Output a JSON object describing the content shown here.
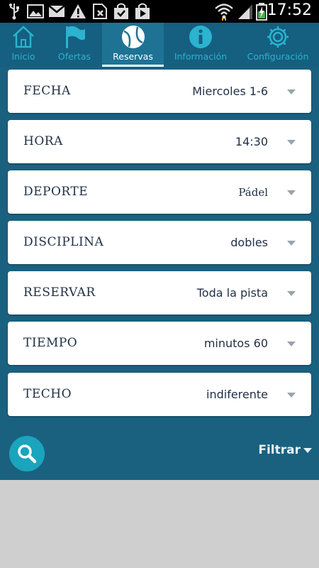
{
  "status_bar": {
    "time": "17:52",
    "icons": [
      "usb-icon",
      "image-icon",
      "gmail-icon",
      "warning-icon",
      "sim-missing-icon",
      "store-icon",
      "play-store-icon",
      "wifi-icon",
      "signal-icon",
      "battery-icon"
    ]
  },
  "nav": {
    "tabs": [
      {
        "label": "Inicio",
        "icon": "home-icon"
      },
      {
        "label": "Ofertas",
        "icon": "flag-icon"
      },
      {
        "label": "Reservas",
        "icon": "tennis-ball-icon",
        "active": true
      },
      {
        "label": "Información",
        "icon": "info-icon"
      },
      {
        "label": "Configuración",
        "icon": "gear-icon"
      }
    ]
  },
  "form": {
    "fields": [
      {
        "label": "FECHA",
        "value": "Miercoles 1-6"
      },
      {
        "label": "HORA",
        "value": "14:30"
      },
      {
        "label": "DEPORTE",
        "value": "Pádel"
      },
      {
        "label": "DISCIPLINA",
        "value": "dobles"
      },
      {
        "label": "RESERVAR",
        "value": "Toda la pista"
      },
      {
        "label": "TIEMPO",
        "value": "minutos 60"
      },
      {
        "label": "TECHO",
        "value": "indiferente"
      }
    ]
  },
  "actions": {
    "search_icon": "search-icon",
    "filter_label": "Filtrar"
  },
  "colors": {
    "nav_background": "#155f80",
    "main_background": "#1a6180",
    "accent": "#1aa4bd",
    "tab_inactive": "#2bb3cf"
  }
}
